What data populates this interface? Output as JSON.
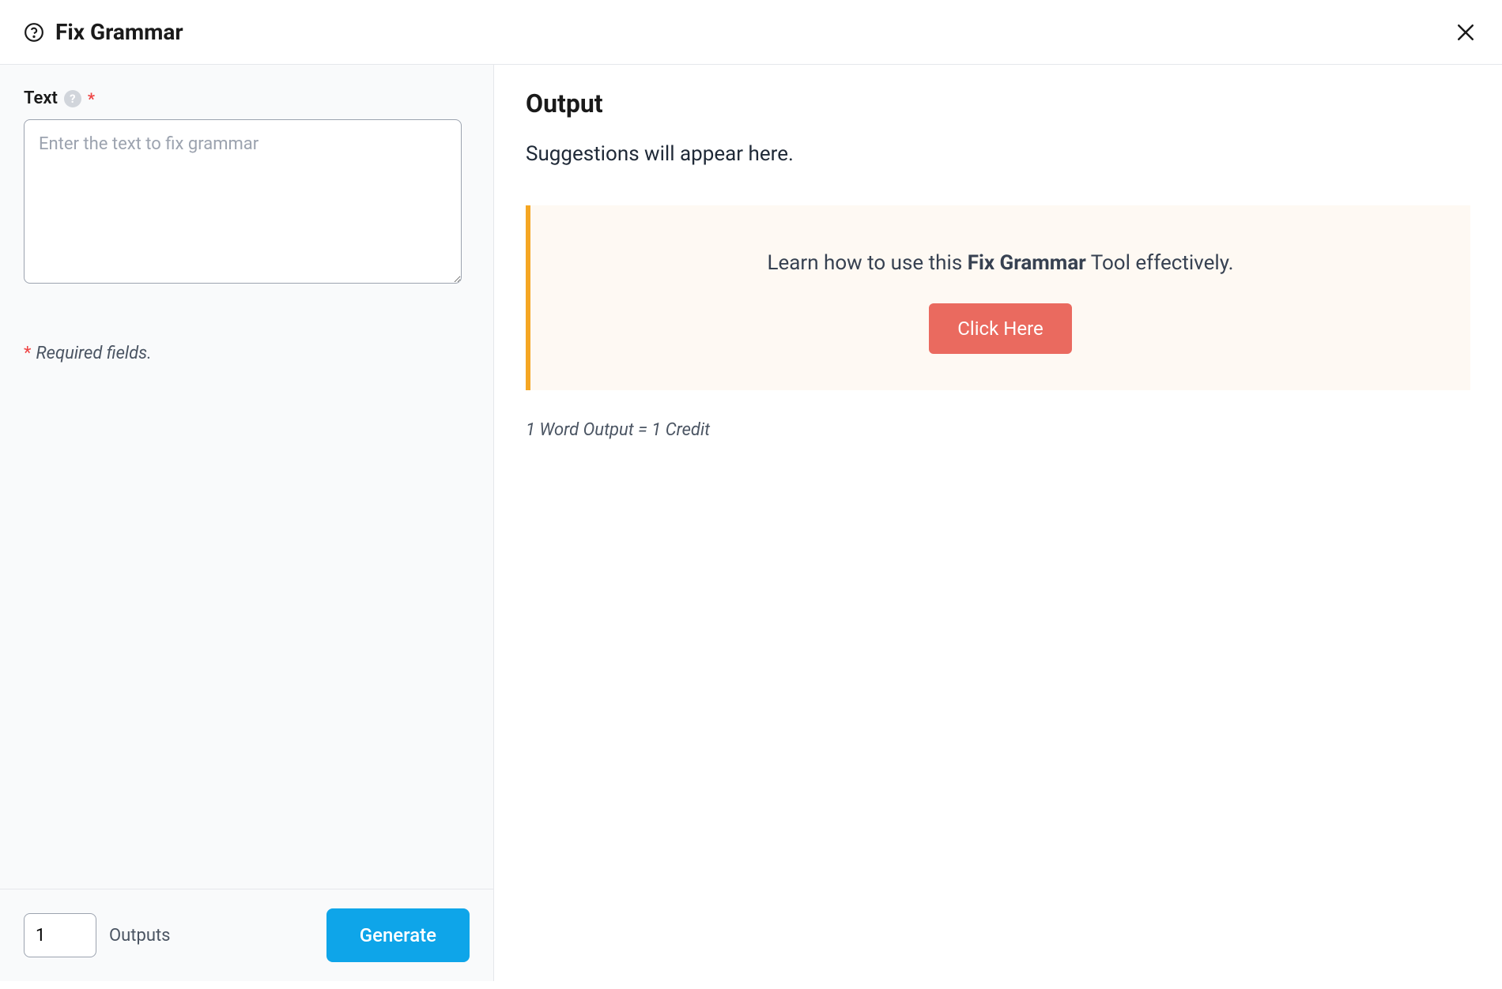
{
  "header": {
    "title": "Fix Grammar"
  },
  "leftPanel": {
    "textField": {
      "label": "Text",
      "placeholder": "Enter the text to fix grammar",
      "value": ""
    },
    "requiredNote": "Required fields.",
    "outputsCount": "1",
    "outputsLabel": "Outputs",
    "generateLabel": "Generate"
  },
  "rightPanel": {
    "outputTitle": "Output",
    "suggestionsText": "Suggestions will appear here.",
    "callout": {
      "prefix": "Learn how to use this ",
      "bold": "Fix Grammar",
      "suffix": " Tool effectively.",
      "buttonLabel": "Click Here"
    },
    "creditNote": "1 Word Output = 1 Credit"
  }
}
